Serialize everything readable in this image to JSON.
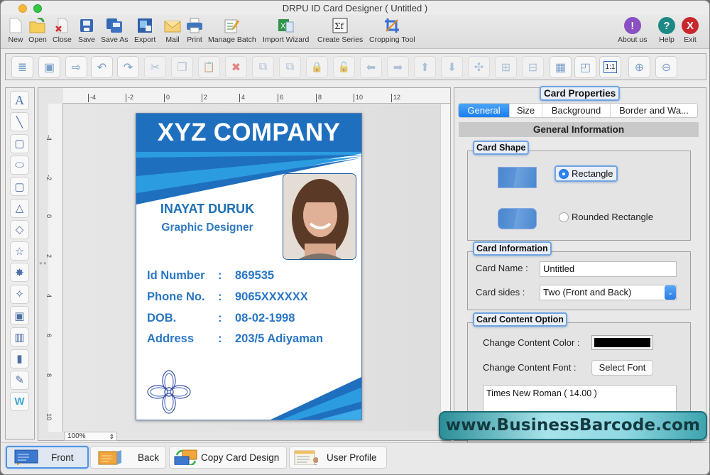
{
  "window": {
    "title": "DRPU ID Card Designer ( Untitled )"
  },
  "main_toolbar": {
    "left": [
      {
        "label": "New",
        "icon": "new-document-icon"
      },
      {
        "label": "Open",
        "icon": "open-folder-icon"
      },
      {
        "label": "Close",
        "icon": "close-document-icon"
      },
      {
        "label": "Save",
        "icon": "save-icon"
      },
      {
        "label": "Save As",
        "icon": "save-as-icon"
      },
      {
        "label": "Export",
        "icon": "export-icon"
      },
      {
        "label": "Mail",
        "icon": "mail-icon"
      },
      {
        "label": "Print",
        "icon": "printer-icon"
      },
      {
        "label": "Manage Batch",
        "icon": "manage-batch-icon"
      },
      {
        "label": "Import Wizard",
        "icon": "import-wizard-icon"
      },
      {
        "label": "Create Series",
        "icon": "create-series-icon"
      },
      {
        "label": "Cropping Tool",
        "icon": "crop-icon"
      }
    ],
    "right": [
      {
        "label": "About us",
        "icon": "info-icon",
        "glyph": "!",
        "color": "#8a4fc1"
      },
      {
        "label": "Help",
        "icon": "help-icon",
        "glyph": "?",
        "color": "#1b8a86"
      },
      {
        "label": "Exit",
        "icon": "exit-icon",
        "glyph": "X",
        "color": "#c8282b"
      }
    ]
  },
  "edit_toolbar": [
    {
      "name": "card-properties",
      "glyph": "≣",
      "enabled": true
    },
    {
      "name": "background-image",
      "glyph": "▣",
      "enabled": true
    },
    {
      "name": "export-image",
      "glyph": "⇨",
      "enabled": true
    },
    {
      "name": "undo",
      "glyph": "↶",
      "enabled": true
    },
    {
      "name": "redo",
      "glyph": "↷",
      "enabled": true
    },
    {
      "name": "cut",
      "glyph": "✂",
      "enabled": false
    },
    {
      "name": "copy",
      "glyph": "❐",
      "enabled": false
    },
    {
      "name": "paste",
      "glyph": "📋",
      "enabled": false
    },
    {
      "name": "delete",
      "glyph": "✖",
      "enabled": false
    },
    {
      "name": "bring-to-front",
      "glyph": "⧉",
      "enabled": false
    },
    {
      "name": "send-to-back",
      "glyph": "⧉",
      "enabled": false
    },
    {
      "name": "lock",
      "glyph": "🔒",
      "enabled": false
    },
    {
      "name": "unlock",
      "glyph": "🔓",
      "enabled": false
    },
    {
      "name": "move-left",
      "glyph": "⬅",
      "enabled": false
    },
    {
      "name": "move-right",
      "glyph": "➡",
      "enabled": false
    },
    {
      "name": "move-up",
      "glyph": "⬆",
      "enabled": false
    },
    {
      "name": "move-down",
      "glyph": "⬇",
      "enabled": false
    },
    {
      "name": "center",
      "glyph": "✣",
      "enabled": false
    },
    {
      "name": "align-horizontal-center",
      "glyph": "⊞",
      "enabled": false
    },
    {
      "name": "align-vertical-center",
      "glyph": "⊟",
      "enabled": false
    },
    {
      "name": "grid",
      "glyph": "▦",
      "enabled": true
    },
    {
      "name": "ruler",
      "glyph": "◰",
      "enabled": true
    },
    {
      "name": "actual-size",
      "glyph": "1:1",
      "enabled": true
    },
    {
      "name": "zoom-in",
      "glyph": "⊕",
      "enabled": true
    },
    {
      "name": "zoom-out",
      "glyph": "⊖",
      "enabled": true
    }
  ],
  "drawing_tools": [
    {
      "name": "text-tool",
      "glyph": "A"
    },
    {
      "name": "line-tool",
      "glyph": "╲"
    },
    {
      "name": "rectangle-tool",
      "glyph": "▢"
    },
    {
      "name": "ellipse-tool",
      "glyph": "⬭"
    },
    {
      "name": "rounded-rectangle-tool",
      "glyph": "▢"
    },
    {
      "name": "triangle-tool",
      "glyph": "△"
    },
    {
      "name": "diamond-tool",
      "glyph": "◇"
    },
    {
      "name": "star-tool",
      "glyph": "☆"
    },
    {
      "name": "burst-tool",
      "glyph": "✸"
    },
    {
      "name": "four-point-star-tool",
      "glyph": "✧"
    },
    {
      "name": "image-tool",
      "glyph": "▣"
    },
    {
      "name": "library-tool",
      "glyph": "▥"
    },
    {
      "name": "barcode-tool",
      "glyph": "▮"
    },
    {
      "name": "signature-tool",
      "glyph": "✎"
    },
    {
      "name": "watermark-tool",
      "glyph": "W"
    }
  ],
  "rulers": {
    "horizontal_ticks": [
      "-4",
      "-2",
      "0",
      "2",
      "4",
      "6",
      "8",
      "10",
      "12"
    ],
    "vertical_ticks": [
      "-4",
      "-2",
      "0",
      "2",
      "4",
      "6",
      "8",
      "10"
    ]
  },
  "canvas": {
    "zoom": "100%"
  },
  "card": {
    "company": "XYZ COMPANY",
    "name": "INAYAT DURUK",
    "role": "Graphic Designer",
    "fields": [
      {
        "label": "Id Number",
        "sep": ":",
        "value": "869535"
      },
      {
        "label": "Phone No.",
        "sep": ":",
        "value": "9065XXXXXX"
      },
      {
        "label": "DOB.",
        "sep": ":",
        "value": "08-02-1998"
      },
      {
        "label": "Address",
        "sep": ":",
        "value": "203/5 Adiyaman"
      }
    ],
    "colors": {
      "primary": "#1f6fbf",
      "accent": "#2b9ce0",
      "text": "#2876c4"
    }
  },
  "properties": {
    "title": "Card Properties",
    "tabs": [
      "General",
      "Size",
      "Background",
      "Border and Wa..."
    ],
    "active_tab": "General",
    "section_title": "General Information",
    "card_shape": {
      "title": "Card Shape",
      "options": [
        "Rectangle",
        "Rounded Rectangle"
      ],
      "selected": "Rectangle"
    },
    "card_information": {
      "title": "Card Information",
      "name_label": "Card Name :",
      "name_value": "Untitled",
      "sides_label": "Card sides :",
      "sides_value": "Two (Front and Back)"
    },
    "content_option": {
      "title": "Card Content Option",
      "color_label": "Change Content Color :",
      "color_value": "#000000",
      "font_label": "Change Content Font :",
      "font_button": "Select Font",
      "font_value": "Times New Roman ( 14.00 )"
    }
  },
  "bottom_bar": [
    {
      "label": "Front",
      "icon": "front-card-icon",
      "active": true
    },
    {
      "label": "Back",
      "icon": "back-card-icon",
      "active": false
    },
    {
      "label": "Copy Card Design",
      "icon": "copy-design-icon",
      "active": false
    },
    {
      "label": "User Profile",
      "icon": "user-profile-icon",
      "active": false
    }
  ],
  "watermark_banner": "www.BusinessBarcode.com"
}
